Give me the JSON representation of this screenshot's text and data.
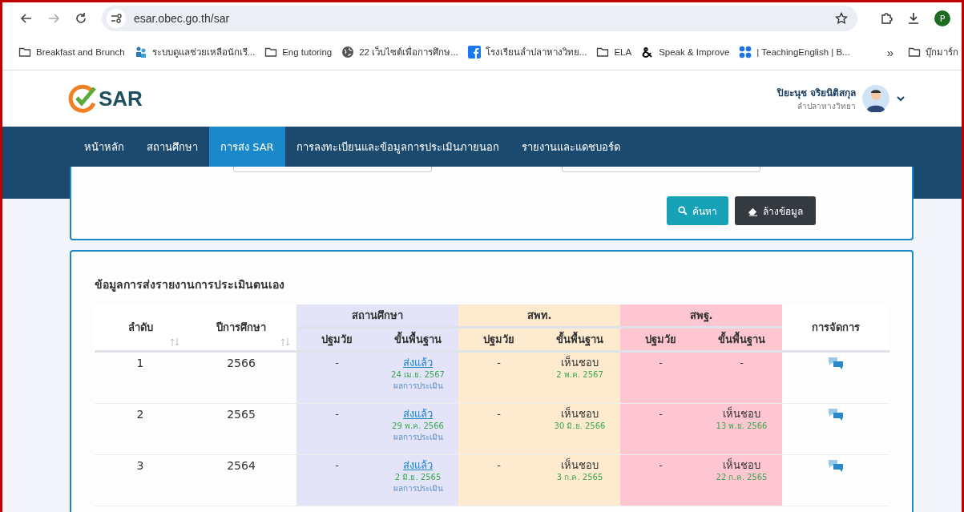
{
  "browser": {
    "url": "esar.obec.go.th/sar",
    "profile_initial": "P",
    "bookmarks": [
      {
        "label": "Breakfast and Brunch",
        "kind": "folder"
      },
      {
        "label": "ระบบดูแลช่วยเหลือนักเรี...",
        "kind": "people"
      },
      {
        "label": "Eng tutoring",
        "kind": "folder"
      },
      {
        "label": "22 เว็บไซต์เพื่อการศึกษ...",
        "kind": "globe"
      },
      {
        "label": "โรงเรียนลำปลาหางวิทย...",
        "kind": "facebook"
      },
      {
        "label": "ELA",
        "kind": "folder"
      },
      {
        "label": "Speak & Improve",
        "kind": "amp"
      },
      {
        "label": "| TeachingEnglish | B...",
        "kind": "grid"
      }
    ],
    "more": "»",
    "other_bookmarks": "บุ๊กมาร์ก"
  },
  "header": {
    "logo_text": "SAR",
    "user_name": "ปิยะนุช จริยนิติสกุล",
    "user_school": "ลำปลาหางวิทยา"
  },
  "nav": [
    {
      "label": "หน้าหลัก",
      "selected": false
    },
    {
      "label": "สถานศึกษา",
      "selected": false
    },
    {
      "label": "การส่ง SAR",
      "selected": true
    },
    {
      "label": "การลงทะเบียนและข้อมูลการประเมินภายนอก",
      "selected": false
    },
    {
      "label": "รายงานและแดชบอร์ด",
      "selected": false
    }
  ],
  "search": {
    "buttons": [
      {
        "label": "ค้นหา",
        "kind": "search"
      },
      {
        "label": "ล้างข้อมูล",
        "kind": "clear"
      }
    ]
  },
  "table": {
    "title": "ข้อมูลการส่งรายงานการประเมินตนเอง",
    "columns": [
      "ลำดับ",
      "ปีการศึกษา"
    ],
    "groups": [
      {
        "label": "สถานศึกษา",
        "color": "#e4e4f8",
        "sub_columns": [
          "ปฐมวัย",
          "ขั้นพื้นฐาน"
        ]
      },
      {
        "label": "สพท.",
        "color": "#fdeacf",
        "sub_columns": [
          "ปฐมวัย",
          "ขั้นพื้นฐาน"
        ]
      },
      {
        "label": "สพฐ.",
        "color": "#fec6d0",
        "sub_columns": [
          "ปฐมวัย",
          "ขั้นพื้นฐาน"
        ]
      }
    ],
    "action_column": "การจัดการ",
    "rows": [
      {
        "order": "1",
        "year": "2566",
        "cells": [
          {
            "kind": "dash",
            "text": "-"
          },
          {
            "kind": "link",
            "text": "ส่งแล้ว",
            "date": "24 เม.ย. 2567",
            "result": "ผลการประเมิน"
          },
          {
            "kind": "dash",
            "text": "-"
          },
          {
            "kind": "text",
            "text": "เห็นชอบ",
            "date": "2 พ.ค. 2567"
          },
          {
            "kind": "dash",
            "text": "-"
          },
          {
            "kind": "dash",
            "text": "-"
          }
        ]
      },
      {
        "order": "2",
        "year": "2565",
        "cells": [
          {
            "kind": "dash",
            "text": "-"
          },
          {
            "kind": "link",
            "text": "ส่งแล้ว",
            "date": "29 พ.ค. 2566",
            "result": "ผลการประเมิน"
          },
          {
            "kind": "dash",
            "text": "-"
          },
          {
            "kind": "text",
            "text": "เห็นชอบ",
            "date": "30 มิ.ย. 2566"
          },
          {
            "kind": "dash",
            "text": "-"
          },
          {
            "kind": "text",
            "text": "เห็นชอบ",
            "date": "13 พ.ย. 2566"
          }
        ]
      },
      {
        "order": "3",
        "year": "2564",
        "cells": [
          {
            "kind": "dash",
            "text": "-"
          },
          {
            "kind": "link",
            "text": "ส่งแล้ว",
            "date": "2 มิ.ย. 2565",
            "result": "ผลการประเมิน"
          },
          {
            "kind": "dash",
            "text": "-"
          },
          {
            "kind": "text",
            "text": "เห็นชอบ",
            "date": "3 ก.ค. 2565"
          },
          {
            "kind": "dash",
            "text": "-"
          },
          {
            "kind": "text",
            "text": "เห็นชอบ",
            "date": "22 ก.ค. 2565"
          }
        ]
      }
    ]
  }
}
